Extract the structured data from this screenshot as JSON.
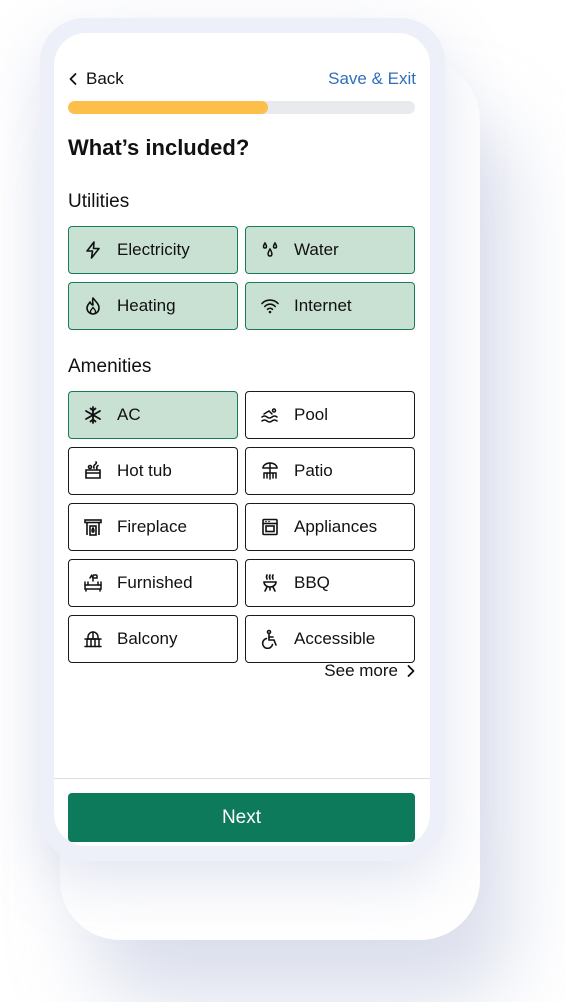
{
  "header": {
    "back_label": "Back",
    "save_exit_label": "Save & Exit"
  },
  "progress": {
    "fraction": 0.576
  },
  "page_title": "What’s included?",
  "utilities": {
    "title": "Utilities",
    "items": [
      {
        "label": "Electricity",
        "icon": "lightning-icon",
        "selected": true
      },
      {
        "label": "Water",
        "icon": "water-icon",
        "selected": true
      },
      {
        "label": "Heating",
        "icon": "flame-icon",
        "selected": true
      },
      {
        "label": "Internet",
        "icon": "wifi-icon",
        "selected": true
      }
    ]
  },
  "amenities": {
    "title": "Amenities",
    "items": [
      {
        "label": "AC",
        "icon": "snowflake-icon",
        "selected": true
      },
      {
        "label": "Pool",
        "icon": "pool-icon",
        "selected": false
      },
      {
        "label": "Hot tub",
        "icon": "hot-tub-icon",
        "selected": false
      },
      {
        "label": "Patio",
        "icon": "patio-icon",
        "selected": false
      },
      {
        "label": "Fireplace",
        "icon": "fireplace-icon",
        "selected": false
      },
      {
        "label": "Appliances",
        "icon": "oven-icon",
        "selected": false
      },
      {
        "label": "Furnished",
        "icon": "sofa-icon",
        "selected": false
      },
      {
        "label": "BBQ",
        "icon": "bbq-icon",
        "selected": false
      },
      {
        "label": "Balcony",
        "icon": "balcony-icon",
        "selected": false
      },
      {
        "label": "Accessible",
        "icon": "accessible-icon",
        "selected": false
      }
    ]
  },
  "see_more_label": "See more",
  "next_label": "Next",
  "colors": {
    "accent": "#0d7a5b",
    "selected_fill": "#c8e1d3",
    "progress": "#fbbf4a",
    "link": "#2f6fb8"
  }
}
